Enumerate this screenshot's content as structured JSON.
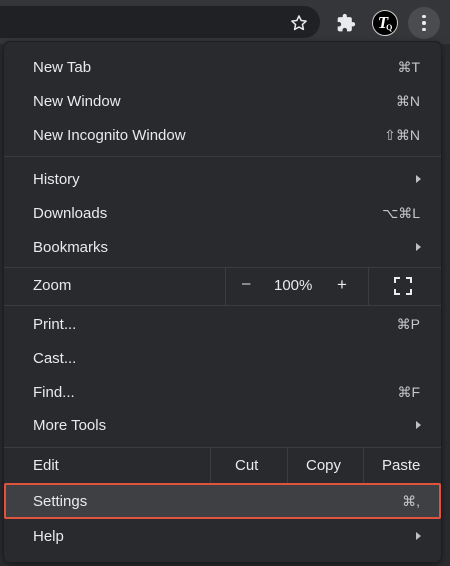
{
  "toolbar": {
    "avatar_text": "T",
    "avatar_sub": "Q",
    "icons": [
      "star-icon",
      "puzzle-icon",
      "avatar",
      "kebab-icon"
    ]
  },
  "menu": {
    "new_tab": {
      "label": "New Tab",
      "shortcut": "⌘T"
    },
    "new_window": {
      "label": "New Window",
      "shortcut": "⌘N"
    },
    "new_incognito": {
      "label": "New Incognito Window",
      "shortcut": "⇧⌘N"
    },
    "history": {
      "label": "History"
    },
    "downloads": {
      "label": "Downloads",
      "shortcut": "⌥⌘L"
    },
    "bookmarks": {
      "label": "Bookmarks"
    },
    "zoom": {
      "label": "Zoom",
      "minus": "–",
      "value": "100%",
      "plus": "+"
    },
    "print": {
      "label": "Print...",
      "shortcut": "⌘P"
    },
    "cast": {
      "label": "Cast..."
    },
    "find": {
      "label": "Find...",
      "shortcut": "⌘F"
    },
    "more_tools": {
      "label": "More Tools"
    },
    "edit": {
      "label": "Edit",
      "cut": "Cut",
      "copy": "Copy",
      "paste": "Paste"
    },
    "settings": {
      "label": "Settings",
      "shortcut": "⌘,"
    },
    "help": {
      "label": "Help"
    }
  },
  "colors": {
    "menu_bg": "#292a2d",
    "highlight_border": "#e0533d"
  }
}
